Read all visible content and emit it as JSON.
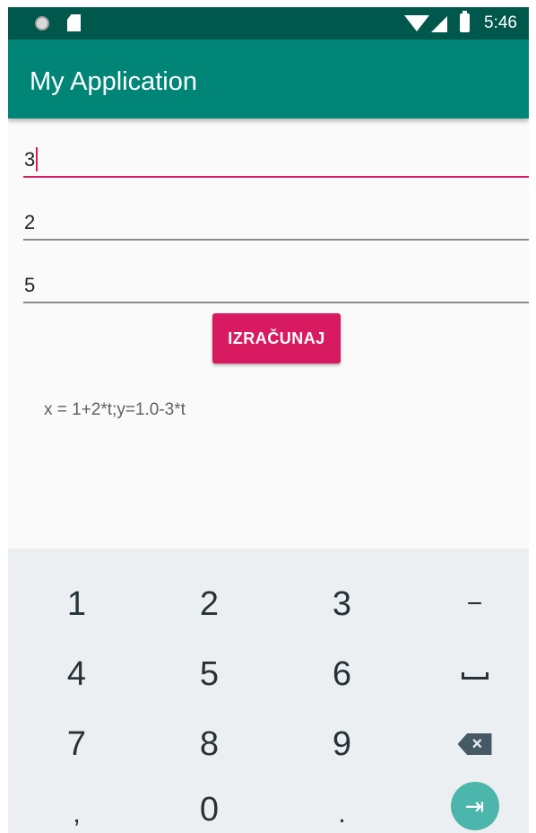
{
  "status_bar": {
    "time": "5:46",
    "icons": [
      "notification-dot-icon",
      "sd-card-icon",
      "wifi-icon",
      "cell-signal-icon",
      "battery-icon"
    ]
  },
  "app_bar": {
    "title": "My Application"
  },
  "inputs": [
    {
      "value": "3",
      "focused": true
    },
    {
      "value": "2",
      "focused": false
    },
    {
      "value": "5",
      "focused": false
    }
  ],
  "calculate_button": {
    "label": "IZRAČUNAJ"
  },
  "result": {
    "text": "x = 1+2*t;y=1.0-3*t"
  },
  "keyboard": {
    "keys": [
      {
        "label": "1",
        "name": "key-1"
      },
      {
        "label": "2",
        "name": "key-2"
      },
      {
        "label": "3",
        "name": "key-3"
      },
      {
        "label": "−",
        "name": "key-minus"
      },
      {
        "label": "4",
        "name": "key-4"
      },
      {
        "label": "5",
        "name": "key-5"
      },
      {
        "label": "6",
        "name": "key-6"
      },
      {
        "label": "",
        "name": "key-space",
        "icon": "space-icon"
      },
      {
        "label": "7",
        "name": "key-7"
      },
      {
        "label": "8",
        "name": "key-8"
      },
      {
        "label": "9",
        "name": "key-9"
      },
      {
        "label": "",
        "name": "key-backspace",
        "icon": "backspace-icon"
      },
      {
        "label": ",",
        "name": "key-comma"
      },
      {
        "label": "0",
        "name": "key-0"
      },
      {
        "label": ".",
        "name": "key-period"
      },
      {
        "label": "",
        "name": "key-next",
        "icon": "next-arrow-icon"
      }
    ]
  },
  "colors": {
    "status_bar": "#00574b",
    "app_bar": "#008577",
    "accent": "#d81b60",
    "keyboard_bg": "#eceff1",
    "next_key": "#4db6ac"
  }
}
